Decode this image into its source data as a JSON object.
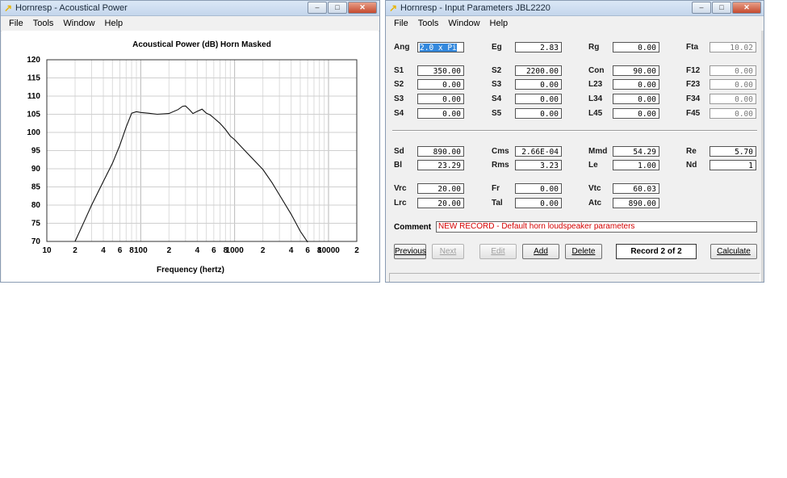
{
  "left_window": {
    "title": "Hornresp - Acoustical Power",
    "menu": [
      "File",
      "Tools",
      "Window",
      "Help"
    ],
    "buttons": {
      "minimize": "–",
      "maximize": "□",
      "close": "✕"
    }
  },
  "right_window": {
    "title": "Hornresp - Input Parameters   JBL2220",
    "menu": [
      "File",
      "Tools",
      "Window",
      "Help"
    ],
    "buttons": {
      "minimize": "–",
      "maximize": "□",
      "close": "✕"
    }
  },
  "chart_data": {
    "type": "line",
    "title": "Acoustical Power (dB)   Horn   Masked",
    "xlabel": "Frequency (hertz)",
    "ylabel": "",
    "x_scale": "log",
    "xlim": [
      10,
      20000
    ],
    "ylim": [
      70,
      120
    ],
    "yticks": [
      70,
      75,
      80,
      85,
      90,
      95,
      100,
      105,
      110,
      115,
      120
    ],
    "xtick_labels": [
      {
        "x": 10,
        "label": "10"
      },
      {
        "x": 20,
        "label": "2"
      },
      {
        "x": 40,
        "label": "4"
      },
      {
        "x": 60,
        "label": "6"
      },
      {
        "x": 80,
        "label": "8"
      },
      {
        "x": 100,
        "label": "100"
      },
      {
        "x": 200,
        "label": "2"
      },
      {
        "x": 400,
        "label": "4"
      },
      {
        "x": 600,
        "label": "6"
      },
      {
        "x": 800,
        "label": "8"
      },
      {
        "x": 1000,
        "label": "1000"
      },
      {
        "x": 2000,
        "label": "2"
      },
      {
        "x": 4000,
        "label": "4"
      },
      {
        "x": 6000,
        "label": "6"
      },
      {
        "x": 8000,
        "label": "8"
      },
      {
        "x": 10000,
        "label": "10000"
      },
      {
        "x": 20000,
        "label": "2"
      }
    ],
    "grid": true,
    "series": [
      {
        "x": [
          20,
          25,
          30,
          40,
          50,
          60,
          70,
          80,
          90,
          100,
          120,
          150,
          200,
          250,
          280,
          300,
          330,
          360,
          400,
          450,
          500,
          550,
          600,
          700,
          800,
          900,
          1000,
          1200,
          1500,
          2000,
          2500,
          3000,
          4000,
          5000,
          6000
        ],
        "y": [
          70,
          75.5,
          80,
          86.5,
          91.5,
          96.5,
          101.5,
          105.3,
          105.7,
          105.5,
          105.3,
          105.0,
          105.2,
          106.3,
          107.2,
          107.3,
          106.3,
          105.2,
          105.8,
          106.4,
          105.3,
          104.8,
          104.0,
          102.5,
          100.8,
          99.0,
          98.0,
          95.8,
          93.2,
          89.8,
          86.2,
          82.8,
          77.5,
          72.8,
          69.8
        ]
      }
    ]
  },
  "form": {
    "fields": [
      {
        "label": "Ang",
        "value": "2.0 x Pi",
        "selected": true
      },
      {
        "label": "Eg",
        "value": "2.83"
      },
      {
        "label": "Rg",
        "value": "0.00"
      },
      {
        "label": "Fta",
        "value": "10.02",
        "dim": true
      },
      {
        "label": "S1",
        "value": "350.00"
      },
      {
        "label": "S2",
        "value": "2200.00"
      },
      {
        "label": "Con",
        "value": "90.00"
      },
      {
        "label": "F12",
        "value": "0.00",
        "dim": true
      },
      {
        "label": "S2",
        "value": "0.00"
      },
      {
        "label": "S3",
        "value": "0.00"
      },
      {
        "label": "L23",
        "value": "0.00"
      },
      {
        "label": "F23",
        "value": "0.00",
        "dim": true
      },
      {
        "label": "S3",
        "value": "0.00"
      },
      {
        "label": "S4",
        "value": "0.00"
      },
      {
        "label": "L34",
        "value": "0.00"
      },
      {
        "label": "F34",
        "value": "0.00",
        "dim": true
      },
      {
        "label": "S4",
        "value": "0.00"
      },
      {
        "label": "S5",
        "value": "0.00"
      },
      {
        "label": "L45",
        "value": "0.00"
      },
      {
        "label": "F45",
        "value": "0.00",
        "dim": true
      },
      {
        "label": "Sd",
        "value": "890.00"
      },
      {
        "label": "Cms",
        "value": "2.66E-04"
      },
      {
        "label": "Mmd",
        "value": "54.29"
      },
      {
        "label": "Re",
        "value": "5.70"
      },
      {
        "label": "Bl",
        "value": "23.29"
      },
      {
        "label": "Rms",
        "value": "3.23"
      },
      {
        "label": "Le",
        "value": "1.00"
      },
      {
        "label": "Nd",
        "value": "1"
      },
      {
        "label": "Vrc",
        "value": "20.00"
      },
      {
        "label": "Fr",
        "value": "0.00"
      },
      {
        "label": "Vtc",
        "value": "60.03"
      },
      {
        "label": "Lrc",
        "value": "20.00"
      },
      {
        "label": "Tal",
        "value": "0.00"
      },
      {
        "label": "Atc",
        "value": "890.00"
      }
    ],
    "comment_label": "Comment",
    "comment": "NEW RECORD - Default horn loudspeaker parameters",
    "buttons": {
      "previous": "Previous",
      "next": "Next",
      "edit": "Edit",
      "add": "Add",
      "delete": "Delete",
      "record": "Record 2 of 2",
      "calculate": "Calculate"
    }
  }
}
